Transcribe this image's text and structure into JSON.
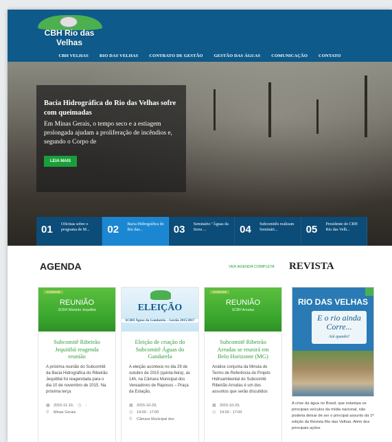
{
  "header": {
    "logo_text": "CBH Rio das Velhas",
    "nav": [
      "CBH VELHAS",
      "RIO DAS VELHAS",
      "CONTRATO DE GESTÃO",
      "GESTÃO DAS ÁGUAS",
      "COMUNICAÇÃO",
      "CONTATO"
    ]
  },
  "hero": {
    "title": "Bacia Hidrográfica do Rio das Velhas sofre com queimadas",
    "text": "Em Minas Gerais, o tempo seco e a estiagem prolongada ajudam a proliferação de incêndios e, segundo o Corpo de",
    "button": "LEIA MAIS"
  },
  "slides": [
    {
      "num": "01",
      "text": "Oficinas sobre o programa de M..."
    },
    {
      "num": "02",
      "text": "Bacia Hidrográfica do Rio das..."
    },
    {
      "num": "03",
      "text": "Seminário \"Águas da Serra ..."
    },
    {
      "num": "04",
      "text": "Subcomitês realizam Seminári..."
    },
    {
      "num": "05",
      "text": "Presidente do CBH Rio das Velh..."
    }
  ],
  "agenda": {
    "title": "AGENDA",
    "link": "VER AGENDA COMPLETA",
    "cards": [
      {
        "img_tag": "CONVITE",
        "img_big": "REUNIÃO",
        "img_small": "SCBH Ribeirão Jequitibá",
        "title": "Subcomitê Ribeirão Jequitibá reagenda reunião",
        "text": "A próxima reunião do Subcomitê da Bacia Hidrográfica do Ribeirão Jequitibá foi reagendada para o dia 10 de novembro de 2015. Na próxima terça",
        "date": "2015-11-10,",
        "time": "-",
        "place": "Minas Gerais"
      },
      {
        "img_big": "ELEIÇÃO",
        "img_small": "SCBH Águas da Gandarela – Gestão 2015/2017",
        "title": "Eleição de criação do Subcomitê Águas do Gandarela",
        "text": "A eleição acontece no dia 29 de outubro de 2015 (quinta-feira), às 14h, na Câmara Municipal dos Vereadores de Raposos – Praça da Estação,",
        "date": "2015-10-29,",
        "time": "14:00 - 17:00",
        "place": "Câmara Municipal dos"
      },
      {
        "img_tag": "CONVITE",
        "img_big": "REUNIÃO",
        "img_small": "SCBH Arrudas",
        "title": "Subcomitê Ribeirão Arrudas se reunirá em Belo Horizonte (MG)",
        "text": "Análise conjunta da Minuta do Termo de Referência do Projeto Hidroambiental do Subcomitê Ribeirão Arrudas é um dos assuntos que serão discutidos",
        "date": "2015-10-29,",
        "time": "14:00 - 17:00"
      }
    ]
  },
  "revista": {
    "title": "REVISTA",
    "mag_title": "RIO DAS VELHAS",
    "mag_script": "E o rio ainda Corre...",
    "mag_question": "Até quando?",
    "text": "A crise da água no Brasil, que estampa os principais veículos da mídia nacional, não poderia deixar de ser o principal assunto da 1ª edição da Revista Rio das Velhas. Além dos principais ações"
  },
  "colors": {
    "header": "#0e5a8a",
    "accent_green": "#1a9e3a",
    "slide_active": "#1b87d2"
  }
}
